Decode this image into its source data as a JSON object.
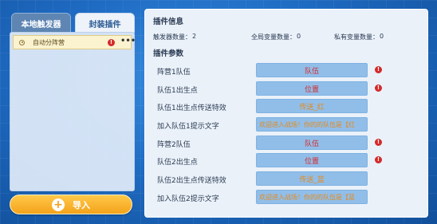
{
  "tabs": {
    "local_triggers": "本地触发器",
    "packaged_plugins": "封装插件"
  },
  "trigger_list": [
    {
      "label": "自动分阵营",
      "has_warning": true
    }
  ],
  "warn_glyph": "!",
  "more_glyph": "•••",
  "import_button": {
    "label": "导入",
    "icon": "plus-icon"
  },
  "plugin_info": {
    "title": "插件信息",
    "trigger_count_label": "触发器数量：",
    "trigger_count": "2",
    "global_vars_label": "全局变量数量：",
    "global_vars": "0",
    "private_vars_label": "私有变量数量：",
    "private_vars": "0"
  },
  "plugin_params": {
    "title": "插件参数",
    "rows": [
      {
        "label": "阵营1队伍",
        "value": "队伍",
        "warning": true
      },
      {
        "label": "队伍1出生点",
        "value": "位置",
        "warning": true
      },
      {
        "label": "队伍1出生点传送特效",
        "value": "传送_红",
        "warning": false
      },
      {
        "label": "加入队伍1提示文字",
        "value": "欢迎进入战场！你的的队伍是【红",
        "warning": false
      },
      {
        "label": "阵营2队伍",
        "value": "队伍",
        "warning": true
      },
      {
        "label": "队伍2出生点",
        "value": "位置",
        "warning": true
      },
      {
        "label": "队伍2出生点传送特效",
        "value": "传送_蓝",
        "warning": false
      },
      {
        "label": "加入队伍2提示文字",
        "value": "欢迎进入战场！你的的队伍是【蓝",
        "warning": false
      }
    ]
  },
  "colors": {
    "warning": "#d42a2a",
    "param_field": "#91bee9",
    "import_button": "#f5a21a",
    "background": "#1f6cc4"
  }
}
